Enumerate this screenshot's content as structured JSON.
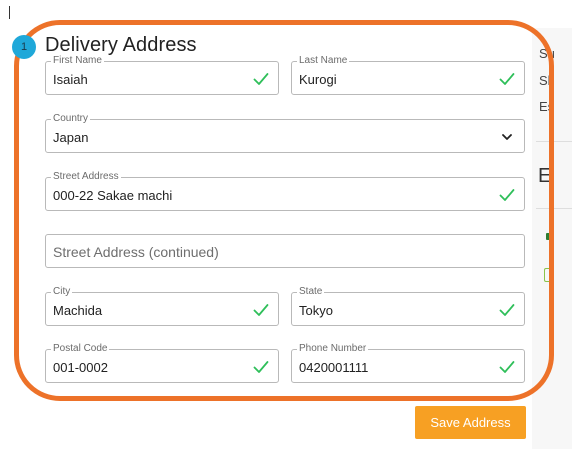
{
  "form": {
    "step_number": "1",
    "title": "Delivery Address",
    "first_name": {
      "label": "First Name",
      "value": "Isaiah"
    },
    "last_name": {
      "label": "Last Name",
      "value": "Kurogi"
    },
    "country": {
      "label": "Country",
      "value": "Japan"
    },
    "street_address": {
      "label": "Street Address",
      "value": "000-22 Sakae machi"
    },
    "street_address_2": {
      "placeholder": "Street Address (continued)"
    },
    "city": {
      "label": "City",
      "value": "Machida"
    },
    "state": {
      "label": "State",
      "value": "Tokyo"
    },
    "postal_code": {
      "label": "Postal Code",
      "value": "001-0002"
    },
    "phone_number": {
      "label": "Phone Number",
      "value": "0420001111"
    },
    "save_label": "Save Address"
  },
  "side_panel": {
    "text_1": "Su",
    "text_2": "Sh",
    "text_3": "Es",
    "heading": "E"
  },
  "colors": {
    "highlight": "#ed7229",
    "save_button": "#f7a023",
    "step_badge": "#1fa8d9",
    "valid_check": "#2fbf5a"
  },
  "icons": {
    "valid": "check-icon",
    "country_dropdown": "chevron-down-icon"
  }
}
